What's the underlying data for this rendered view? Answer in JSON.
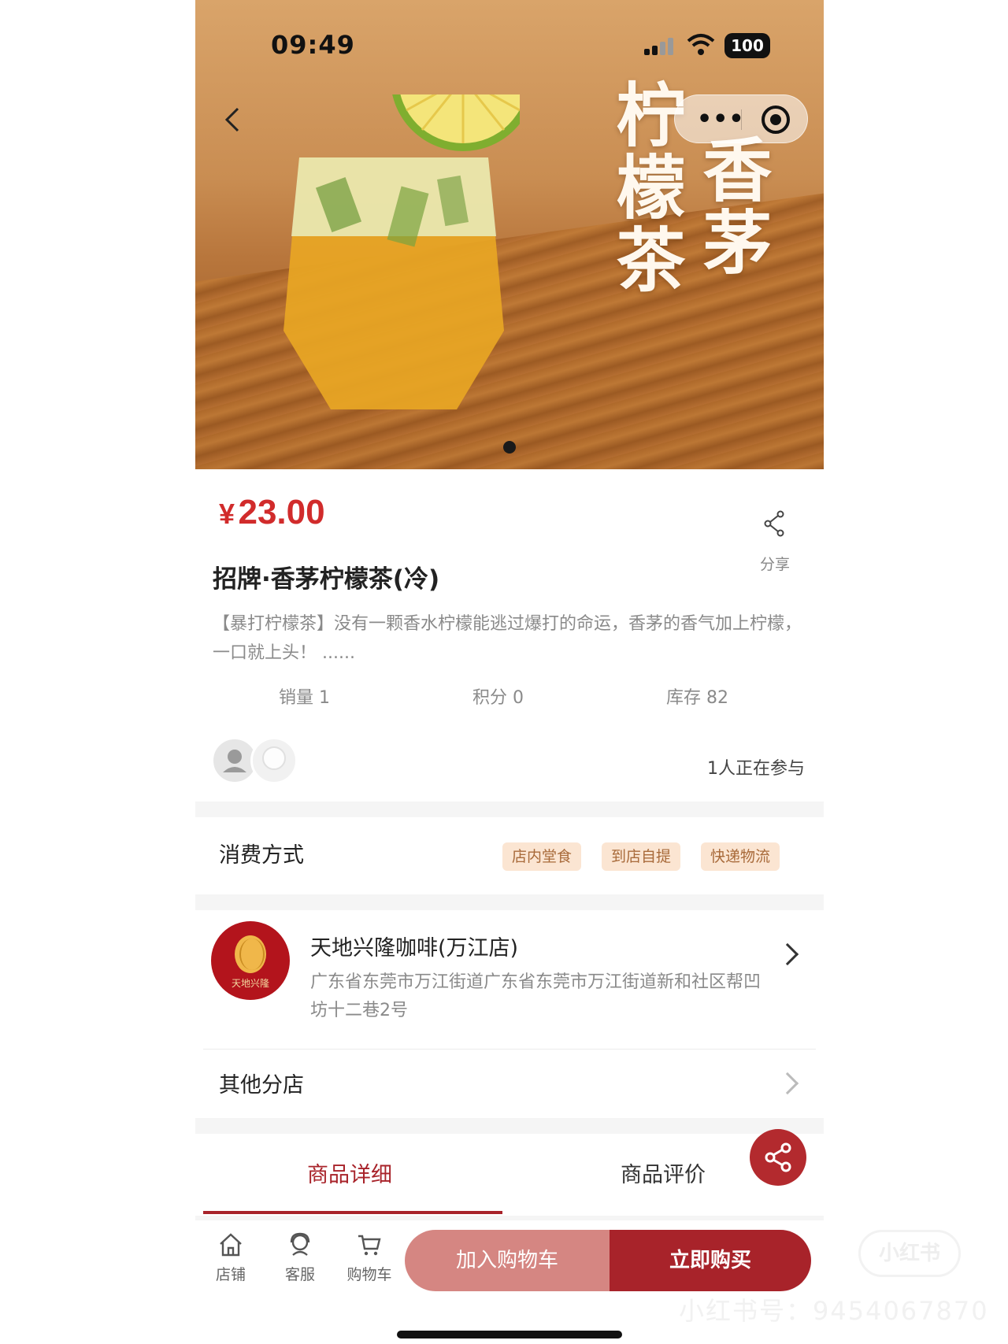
{
  "status_bar": {
    "time": "09:49",
    "battery": "100"
  },
  "hero": {
    "calligraphy_col1": "柠檬茶",
    "calligraphy_col2": "香茅",
    "more_icon": "•••"
  },
  "product": {
    "currency": "¥",
    "price": "23.00",
    "share_label": "分享",
    "title": "招牌·香茅柠檬茶(冷)",
    "description": "【暴打柠檬茶】没有一颗香水柠檬能逃过爆打的命运，香茅的香气加上柠檬，一口就上头！ ......",
    "stats": {
      "sales": "销量 1",
      "points": "积分 0",
      "stock": "库存 82"
    },
    "participants_text": "1人正在参与"
  },
  "consume": {
    "label": "消费方式",
    "tags": [
      "店内堂食",
      "到店自提",
      "快递物流"
    ]
  },
  "shop": {
    "logo_text": "天地兴隆",
    "name": "天地兴隆咖啡(万江店)",
    "address": "广东省东莞市万江街道广东省东莞市万江街道新和社区帮凹坊十二巷2号"
  },
  "branches": {
    "label": "其他分店"
  },
  "tabs": [
    {
      "label": "商品详细",
      "active": true
    },
    {
      "label": "商品评价",
      "active": false
    }
  ],
  "bottom_bar": {
    "nav": [
      {
        "label": "店铺",
        "icon": "store-icon"
      },
      {
        "label": "客服",
        "icon": "customer-service-icon"
      },
      {
        "label": "购物车",
        "icon": "cart-icon"
      }
    ],
    "add_to_cart": "加入购物车",
    "buy_now": "立即购买"
  },
  "watermark": {
    "line": "小红书号：9454067870",
    "logo": "小红书"
  },
  "colors": {
    "accent": "#a8232a",
    "price": "#d12b2b",
    "cart_button": "#d58682",
    "tag_bg": "#fbe5d2"
  }
}
